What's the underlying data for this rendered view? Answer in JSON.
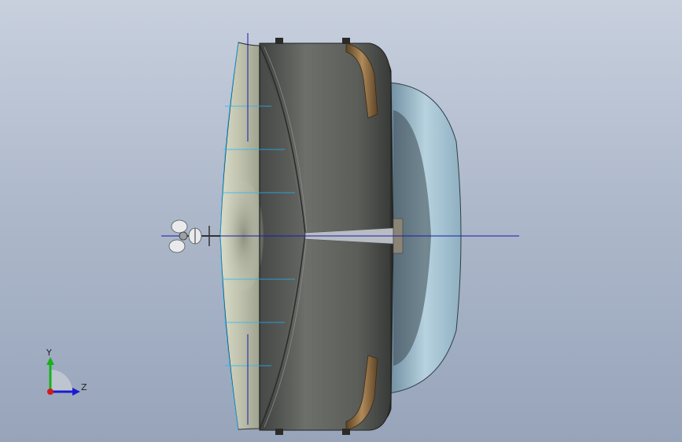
{
  "viewport": {
    "triad": {
      "y_label": "Y",
      "z_label": "Z"
    }
  },
  "colors": {
    "axis_blue": "#1b1bb0",
    "sketch_cyan": "#1fb4ff",
    "shell_dark": "#4b4d4a",
    "shell_mid": "#6c6e6a",
    "bronze_strap": "#7a6040",
    "fan_blue": "#a9c6d6"
  }
}
